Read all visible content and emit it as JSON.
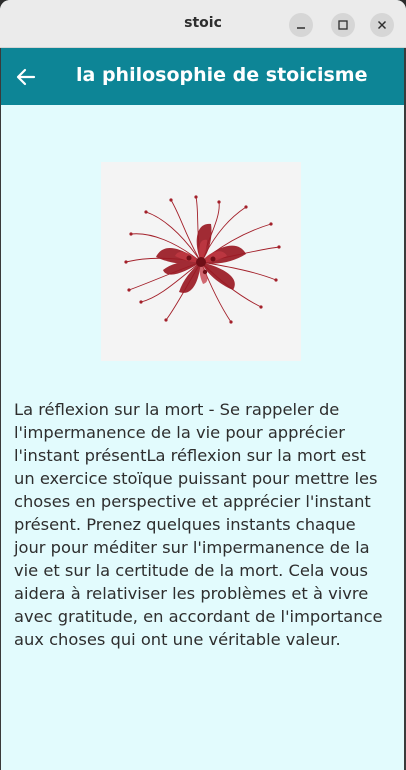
{
  "window": {
    "title": "stoic"
  },
  "appbar": {
    "title": "la philosophie de stoicisme"
  },
  "content": {
    "body": "La réflexion sur la mort - Se rappeler de l'impermanence de la vie pour apprécier l'instant présentLa réflexion sur la mort est un exercice stoïque puissant pour mettre les choses en perspective et apprécier l'instant présent. Prenez quelques instants chaque jour pour méditer sur l'impermanence de la vie et sur la certitude de la mort. Cela vous aidera à relativiser les problèmes et à vivre avec gratitude, en accordant de l'importance aux choses qui ont une véritable valeur."
  },
  "colors": {
    "appbar": "#0d8596",
    "background": "#e2fbfd",
    "flower": "#a3202a"
  },
  "icons": {
    "back": "arrow-back-icon",
    "minimize": "minimize-icon",
    "maximize": "maximize-icon",
    "close": "close-icon"
  }
}
